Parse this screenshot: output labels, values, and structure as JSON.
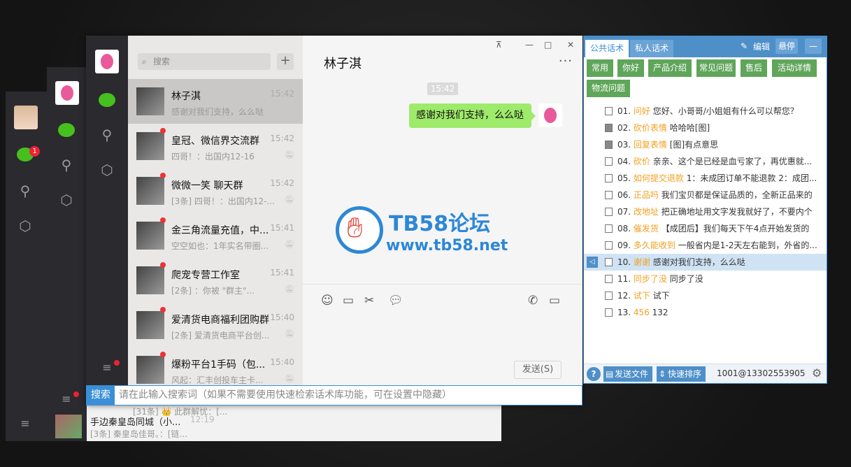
{
  "chat_list": [
    {
      "name": "林子淇",
      "time": "15:42",
      "msg": "感谢对我们支持，么么哒",
      "selected": true,
      "dot": false
    },
    {
      "name": "皇冠、微信界交流群",
      "time": "15:42",
      "msg": "四哥！：出国内12-16",
      "dot": true
    },
    {
      "name": "微微一笑 聊天群",
      "time": "15:42",
      "msg": "[3条] 四哥！：出国内12-...",
      "dot": true
    },
    {
      "name": "金三角流量充值，中...",
      "time": "15:41",
      "msg": "空空如也：1年实名带圈...",
      "dot": true
    },
    {
      "name": "爬宠专营工作室",
      "time": "15:41",
      "msg": "[2条] ：你被 \"群主\"...",
      "dot": true
    },
    {
      "name": "爱清货电商福利团购群",
      "time": "15:40",
      "msg": "[2条] 爱清货电商平台创...",
      "dot": true
    },
    {
      "name": "爆粉平台1手码（包...",
      "time": "15:40",
      "msg": "风起：汇丰创投车主卡...",
      "dot": true
    }
  ],
  "search_placeholder": "搜索",
  "chat": {
    "title": "林子淇",
    "timestamp": "15:42",
    "message": "感谢对我们支持，么么哒",
    "send_label": "发送(S)"
  },
  "bottom_search": {
    "label": "搜索",
    "placeholder": "请在此输入搜索词（如果不需要使用快速检索话术库功能，可在设置中隐藏）"
  },
  "back_windows": {
    "badge": "1",
    "row1_msg": "[31条] 👑 此群解忧：[...",
    "row2_name": "手边秦皇岛同城（小...",
    "row2_time": "12:19",
    "row2_msg": "[3条] 秦皇岛佳哥。：[链..."
  },
  "watermark": {
    "line1": "TB58论坛",
    "line2": "www.tb58.net"
  },
  "panel": {
    "tab_public": "公共话术",
    "tab_private": "私人话术",
    "edit": "编辑",
    "float": "悬停",
    "minimize": "—",
    "categories": [
      "常用",
      "你好",
      "产品介绍",
      "常见问题",
      "售后",
      "活动详情",
      "物流问题"
    ],
    "items": [
      {
        "num": "01.",
        "key": "问好",
        "text": "您好、小哥哥/小姐姐有什么可以帮您？",
        "icon": "doc"
      },
      {
        "num": "02.",
        "key": "砍价表情",
        "text": "哈哈哈[图]",
        "icon": "img"
      },
      {
        "num": "03.",
        "key": "回复表情",
        "text": "[图]有点意思",
        "icon": "img"
      },
      {
        "num": "04.",
        "key": "砍价",
        "text": "亲亲、这个是已经是血亏家了，再优惠就...",
        "icon": "doc"
      },
      {
        "num": "05.",
        "key": "如何提交退款",
        "text": "1：未成团订单不能退款 2：成团...",
        "icon": "doc"
      },
      {
        "num": "06.",
        "key": "正品吗",
        "text": "我们宝贝都是保证品质的，全新正品来的",
        "icon": "doc"
      },
      {
        "num": "07.",
        "key": "改地址",
        "text": "把正确地址用文字发我就好了，不要内个",
        "icon": "doc"
      },
      {
        "num": "08.",
        "key": "催发货",
        "text": "【成团后】我们每天下午4点开始发货的",
        "icon": "doc"
      },
      {
        "num": "09.",
        "key": "多久能收到",
        "text": "一般省内是1-2天左右能到，外省的...",
        "icon": "doc"
      },
      {
        "num": "10.",
        "key": "谢谢",
        "text": "感谢对我们支持，么么哒",
        "icon": "doc",
        "selected": true
      },
      {
        "num": "11.",
        "key": "同步了没",
        "text": "同步了没",
        "icon": "doc"
      },
      {
        "num": "12.",
        "key": "试下",
        "text": "试下",
        "icon": "doc"
      },
      {
        "num": "13.",
        "key": "456",
        "text": "132",
        "icon": "doc"
      }
    ],
    "footer": {
      "help": "?",
      "send_file": "发送文件",
      "sort": "快速排序",
      "account": "1001@13302553905"
    }
  }
}
